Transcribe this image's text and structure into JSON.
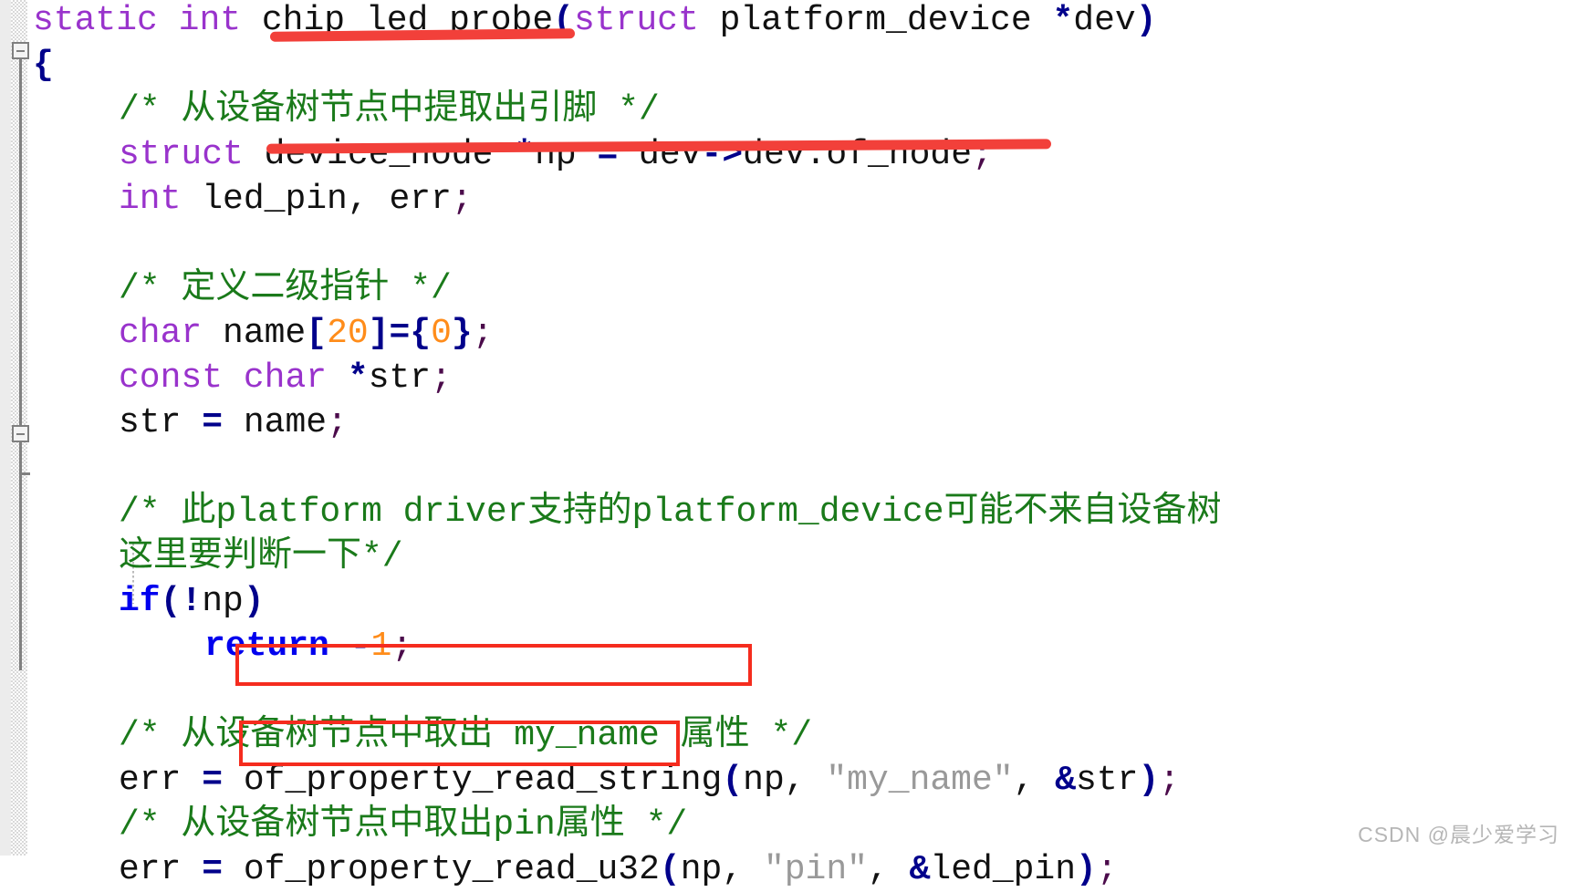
{
  "app": {
    "kind": "source-code-editor",
    "language": "C",
    "watermark": "CSDN @晨少爱学习"
  },
  "colors": {
    "keyword_purple": "#9933cc",
    "keyword_blue": "#0000ee",
    "comment_green": "#1a7a1a",
    "number_orange": "#ff8c1a",
    "string_gray": "#999999",
    "operator_navy": "#00008b",
    "plain_text": "#111111",
    "annotation_red": "#f52c1e",
    "gutter_gray": "#ececec",
    "watermark_gray": "#b6b6b6"
  },
  "gutter": {
    "fold_markers": [
      {
        "name": "fold-marker-function-body",
        "glyph": "minus-box"
      },
      {
        "name": "fold-marker-comment-block",
        "glyph": "minus-box"
      }
    ]
  },
  "code": {
    "lines": [
      {
        "n": 1,
        "indent": 0,
        "tokens": [
          {
            "t": "static",
            "c": "kw"
          },
          {
            "t": " ",
            "c": "plain"
          },
          {
            "t": "int",
            "c": "kw"
          },
          {
            "t": " ",
            "c": "plain"
          },
          {
            "t": "chip_led_probe",
            "c": "ident"
          },
          {
            "t": "(",
            "c": "op"
          },
          {
            "t": "struct",
            "c": "kw"
          },
          {
            "t": " platform_device ",
            "c": "ident"
          },
          {
            "t": "*",
            "c": "op"
          },
          {
            "t": "dev",
            "c": "ident"
          },
          {
            "t": ")",
            "c": "op"
          }
        ]
      },
      {
        "n": 2,
        "indent": 0,
        "tokens": [
          {
            "t": "{",
            "c": "op"
          }
        ]
      },
      {
        "n": 3,
        "indent": 1,
        "tokens": [
          {
            "t": "/* 从设备树节点中提取出引脚 */",
            "c": "comment"
          }
        ]
      },
      {
        "n": 4,
        "indent": 1,
        "tokens": [
          {
            "t": "struct",
            "c": "kw"
          },
          {
            "t": " device_node ",
            "c": "ident"
          },
          {
            "t": "*",
            "c": "op"
          },
          {
            "t": "np ",
            "c": "ident"
          },
          {
            "t": "=",
            "c": "op"
          },
          {
            "t": " dev",
            "c": "ident"
          },
          {
            "t": "->",
            "c": "op"
          },
          {
            "t": "dev.of_node",
            "c": "ident"
          },
          {
            "t": ";",
            "c": "punct"
          }
        ]
      },
      {
        "n": 5,
        "indent": 1,
        "tokens": [
          {
            "t": "int",
            "c": "kw"
          },
          {
            "t": " led_pin, err",
            "c": "ident"
          },
          {
            "t": ";",
            "c": "punct"
          }
        ]
      },
      {
        "n": 6,
        "indent": 1,
        "tokens": []
      },
      {
        "n": 7,
        "indent": 1,
        "tokens": [
          {
            "t": "/* 定义二级指针 */",
            "c": "comment"
          }
        ]
      },
      {
        "n": 8,
        "indent": 1,
        "tokens": [
          {
            "t": "char",
            "c": "kw"
          },
          {
            "t": " name",
            "c": "ident"
          },
          {
            "t": "[",
            "c": "op"
          },
          {
            "t": "20",
            "c": "num"
          },
          {
            "t": "]",
            "c": "op"
          },
          {
            "t": "=",
            "c": "op"
          },
          {
            "t": "{",
            "c": "op"
          },
          {
            "t": "0",
            "c": "num"
          },
          {
            "t": "}",
            "c": "op"
          },
          {
            "t": ";",
            "c": "punct"
          }
        ]
      },
      {
        "n": 9,
        "indent": 1,
        "tokens": [
          {
            "t": "const",
            "c": "kw"
          },
          {
            "t": " ",
            "c": "plain"
          },
          {
            "t": "char",
            "c": "kw"
          },
          {
            "t": " ",
            "c": "plain"
          },
          {
            "t": "*",
            "c": "op"
          },
          {
            "t": "str",
            "c": "ident"
          },
          {
            "t": ";",
            "c": "punct"
          }
        ]
      },
      {
        "n": 10,
        "indent": 1,
        "tokens": [
          {
            "t": "str ",
            "c": "ident"
          },
          {
            "t": "=",
            "c": "op"
          },
          {
            "t": " name",
            "c": "ident"
          },
          {
            "t": ";",
            "c": "punct"
          }
        ]
      },
      {
        "n": 11,
        "indent": 1,
        "tokens": []
      },
      {
        "n": 12,
        "indent": 1,
        "tokens": [
          {
            "t": "/* 此platform driver支持的platform_device可能不来自设备树",
            "c": "comment"
          }
        ]
      },
      {
        "n": 13,
        "indent": 1,
        "tokens": [
          {
            "t": "这里要判断一下*/",
            "c": "comment"
          }
        ]
      },
      {
        "n": 14,
        "indent": 1,
        "tokens": [
          {
            "t": "if",
            "c": "kw-blue"
          },
          {
            "t": "(",
            "c": "op"
          },
          {
            "t": "!",
            "c": "op"
          },
          {
            "t": "np",
            "c": "ident"
          },
          {
            "t": ")",
            "c": "op"
          }
        ]
      },
      {
        "n": 15,
        "indent": 2,
        "tokens": [
          {
            "t": "return",
            "c": "kw-blue"
          },
          {
            "t": " ",
            "c": "plain"
          },
          {
            "t": "-",
            "c": "op"
          },
          {
            "t": "1",
            "c": "num"
          },
          {
            "t": ";",
            "c": "punct"
          }
        ]
      },
      {
        "n": 16,
        "indent": 1,
        "tokens": []
      },
      {
        "n": 17,
        "indent": 1,
        "tokens": [
          {
            "t": "/* 从设备树节点中取出 my_name 属性 */",
            "c": "comment"
          }
        ]
      },
      {
        "n": 18,
        "indent": 1,
        "tokens": [
          {
            "t": "err ",
            "c": "ident"
          },
          {
            "t": "=",
            "c": "op"
          },
          {
            "t": " of_property_read_string",
            "c": "ident"
          },
          {
            "t": "(",
            "c": "op"
          },
          {
            "t": "np, ",
            "c": "ident"
          },
          {
            "t": "\"my_name\"",
            "c": "str"
          },
          {
            "t": ", ",
            "c": "ident"
          },
          {
            "t": "&",
            "c": "op"
          },
          {
            "t": "str",
            "c": "ident"
          },
          {
            "t": ")",
            "c": "op"
          },
          {
            "t": ";",
            "c": "punct"
          }
        ]
      },
      {
        "n": 19,
        "indent": 1,
        "tokens": [
          {
            "t": "/* 从设备树节点中取出pin属性 */",
            "c": "comment"
          }
        ]
      },
      {
        "n": 20,
        "indent": 1,
        "tokens": [
          {
            "t": "err ",
            "c": "ident"
          },
          {
            "t": "=",
            "c": "op"
          },
          {
            "t": " of_property_read_u32",
            "c": "ident"
          },
          {
            "t": "(",
            "c": "op"
          },
          {
            "t": "np, ",
            "c": "ident"
          },
          {
            "t": "\"pin\"",
            "c": "str"
          },
          {
            "t": ", ",
            "c": "ident"
          },
          {
            "t": "&",
            "c": "op"
          },
          {
            "t": "led_pin",
            "c": "ident"
          },
          {
            "t": ")",
            "c": "op"
          },
          {
            "t": ";",
            "c": "punct"
          }
        ]
      }
    ]
  },
  "annotations": {
    "underlines": [
      {
        "name": "red-underline-function-name",
        "target": "chip_led_probe"
      },
      {
        "name": "red-underline-of-node-assignment",
        "target": "struct device_node *np = dev->dev.of_node;"
      }
    ],
    "boxes": [
      {
        "name": "red-box-of-property-read-string",
        "target": "of_property_read_string"
      },
      {
        "name": "red-box-of-property-read-u32",
        "target": "of_property_read_u32"
      }
    ]
  }
}
